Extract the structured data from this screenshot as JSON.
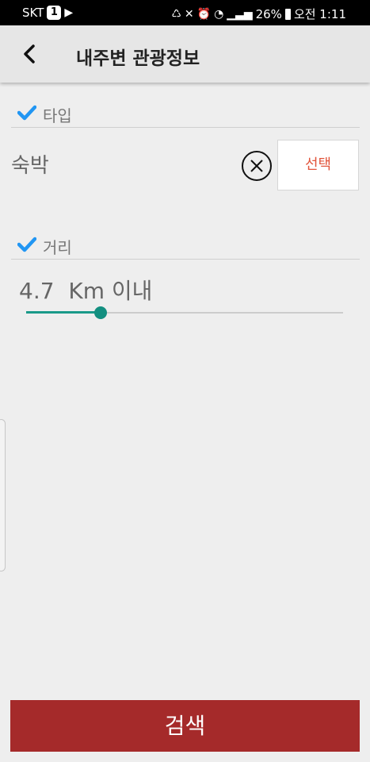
{
  "status_bar": {
    "carrier": "SKT",
    "sim_badge": "1",
    "battery": "26%",
    "time": "오전 1:11"
  },
  "app_bar": {
    "title": "내주변 관광정보"
  },
  "type_section": {
    "label": "타입",
    "value": "숙박",
    "select_label": "선택"
  },
  "distance_section": {
    "label": "거리",
    "value_text": "4.7  Km 이내",
    "slider_fraction": 0.235
  },
  "search_button": {
    "label": "검색"
  },
  "colors": {
    "accent_check": "#2196f3",
    "slider": "#1a9989",
    "select_text": "#e2553c",
    "search_button": "#a52a2a"
  },
  "icons": [
    "back-arrow-icon",
    "check-icon",
    "clear-circle-x-icon"
  ]
}
